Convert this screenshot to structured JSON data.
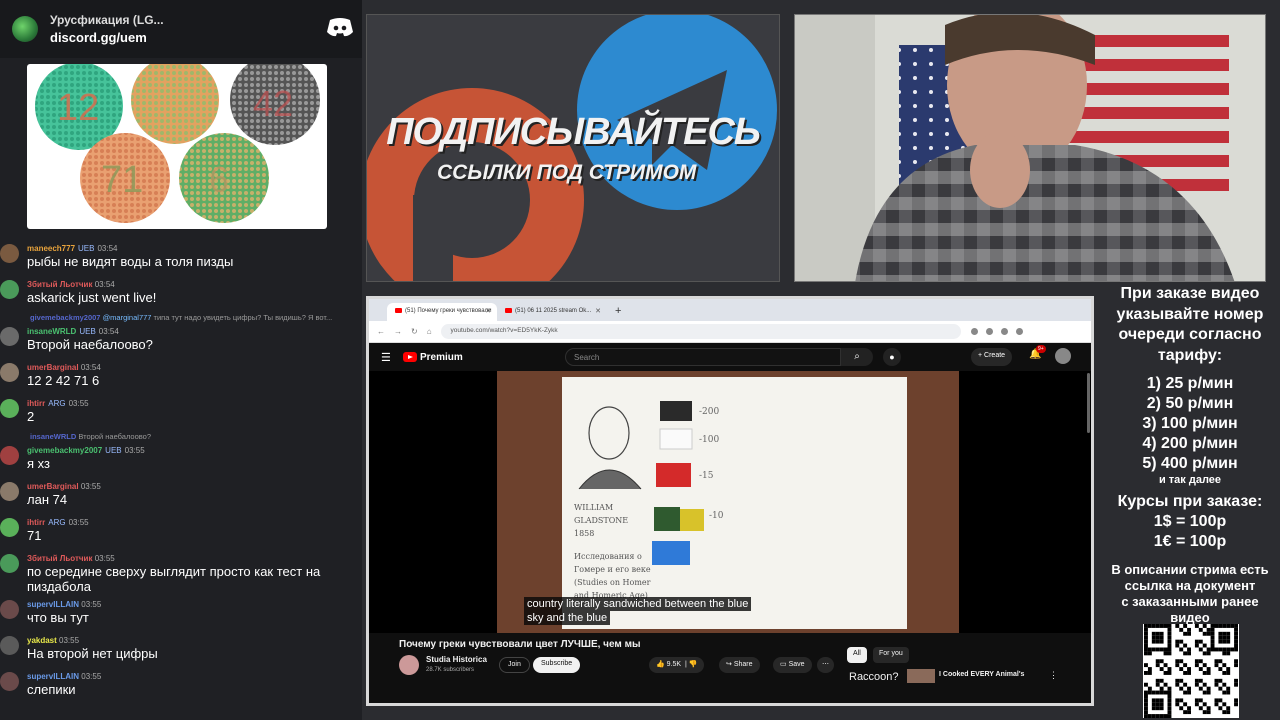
{
  "discord": {
    "server_name": "Урусфикация (LG...",
    "invite": "discord.gg/uem"
  },
  "chat": [
    {
      "user": "maneech777",
      "badge": "UEB",
      "time": "03:54",
      "text": "рыбы не видят воды а толя пизды",
      "name_color": "#e8a33c",
      "avatar_color": "#7a5a40"
    },
    {
      "user": "Збитый Льотчик",
      "badge": "",
      "time": "03:54",
      "text": "askarick just went live!",
      "name_color": "#e05a5a",
      "avatar_color": "#4a9a5a"
    },
    {
      "user": "insaneWRLD",
      "badge": "UEB",
      "time": "03:54",
      "text": "Второй наебалоово?",
      "name_color": "#4ac070",
      "avatar_color": "#6a6a6a",
      "reply": {
        "name": "givemebackmy2007",
        "mention": "@marginal777",
        "text": "типа тут надо увидеть цифры? Ты видишь? Я вот..."
      }
    },
    {
      "user": "umerBarginal",
      "badge": "",
      "time": "03:54",
      "text": "12 2 42 71 6",
      "name_color": "#e05a5a",
      "avatar_color": "#8a7a6a"
    },
    {
      "user": "ihtirr",
      "badge": "ARG",
      "time": "03:55",
      "text": "2",
      "name_color": "#e05a5a",
      "avatar_color": "#5ab05a"
    },
    {
      "user": "givemebackmy2007",
      "badge": "UEB",
      "time": "03:55",
      "text": "я хз",
      "name_color": "#4ac070",
      "avatar_color": "#a04040",
      "reply": {
        "name": "insaneWRLD",
        "mention": "",
        "text": "Второй наебалоово?"
      }
    },
    {
      "user": "umerBarginal",
      "badge": "",
      "time": "03:55",
      "text": "лан 74",
      "name_color": "#e05a5a",
      "avatar_color": "#8a7a6a"
    },
    {
      "user": "ihtirr",
      "badge": "ARG",
      "time": "03:55",
      "text": "71",
      "name_color": "#e05a5a",
      "avatar_color": "#5ab05a"
    },
    {
      "user": "Збитый Льотчик",
      "badge": "",
      "time": "03:55",
      "text": "по середине сверху выглядит просто как тест на",
      "text2": "пиздабола",
      "name_color": "#e05a5a",
      "avatar_color": "#4a9a5a"
    },
    {
      "user": "supervILLAIN",
      "badge": "",
      "time": "03:55",
      "text": "что вы тут",
      "name_color": "#6a9ae8",
      "avatar_color": "#6a4a4a"
    },
    {
      "user": "yakdast",
      "badge": "",
      "time": "03:55",
      "text": "На второй нет цифры",
      "name_color": "#e8e84a",
      "avatar_color": "#5a5a5a"
    },
    {
      "user": "supervILLAIN",
      "badge": "",
      "time": "03:55",
      "text": "слепики",
      "name_color": "#6a9ae8",
      "avatar_color": "#6a4a4a"
    }
  ],
  "banner": {
    "line1": "ПОДПИСЫВАЙТЕСЬ",
    "line2": "ССЫЛКИ ПОД СТРИМОМ"
  },
  "browser": {
    "tabs": [
      "(51) Почему греки чувствовали",
      "(51) 06 11 2025 stream Ok..."
    ],
    "url": "youtube.com/watch?v=ED5YkK-Zykk"
  },
  "youtube": {
    "logo": "Premium",
    "search_placeholder": "Search",
    "create": "Create",
    "notif_count": "9+",
    "caption_line1": "country literally sandwiched between the blue",
    "caption_line2": "sky and the blue",
    "video_title": "Почему греки чувствовали цвет ЛУЧШЕ, чем мы",
    "channel": "Studia Historica",
    "subscribers": "28.7K subscribers",
    "join": "Join",
    "subscribe": "Subscribe",
    "likes": "9.5K",
    "share": "Share",
    "save": "Save",
    "chip_all": "All",
    "chip_for_you": "For you",
    "rec1": "Raccoon?",
    "rec2": "I Cooked EVERY Animal's"
  },
  "paper": {
    "handwriting": [
      "WILLIAM",
      "GLADSTONE",
      "1858",
      "Исследования о",
      "Гомере и его веке",
      "(Studies on Homer",
      "and Homeric Age)"
    ],
    "swatches": [
      "-200",
      "-100",
      "-15",
      "-10"
    ]
  },
  "info": {
    "p1": [
      "При заказе видео",
      "указывайте номер",
      "очереди согласно",
      "тарифу:"
    ],
    "prices": [
      "1) 25 р/мин",
      "2) 50 р/мин",
      "3) 100 р/мин",
      "4) 200 р/мин",
      "5) 400 р/мин"
    ],
    "etc": "и так далее",
    "courses": [
      "Курсы при заказе:",
      "1$ = 100р",
      "1€ = 100р"
    ],
    "desc": [
      "В описании стрима есть",
      "ссылка на документ",
      "с заказанными ранее",
      "видео"
    ]
  }
}
